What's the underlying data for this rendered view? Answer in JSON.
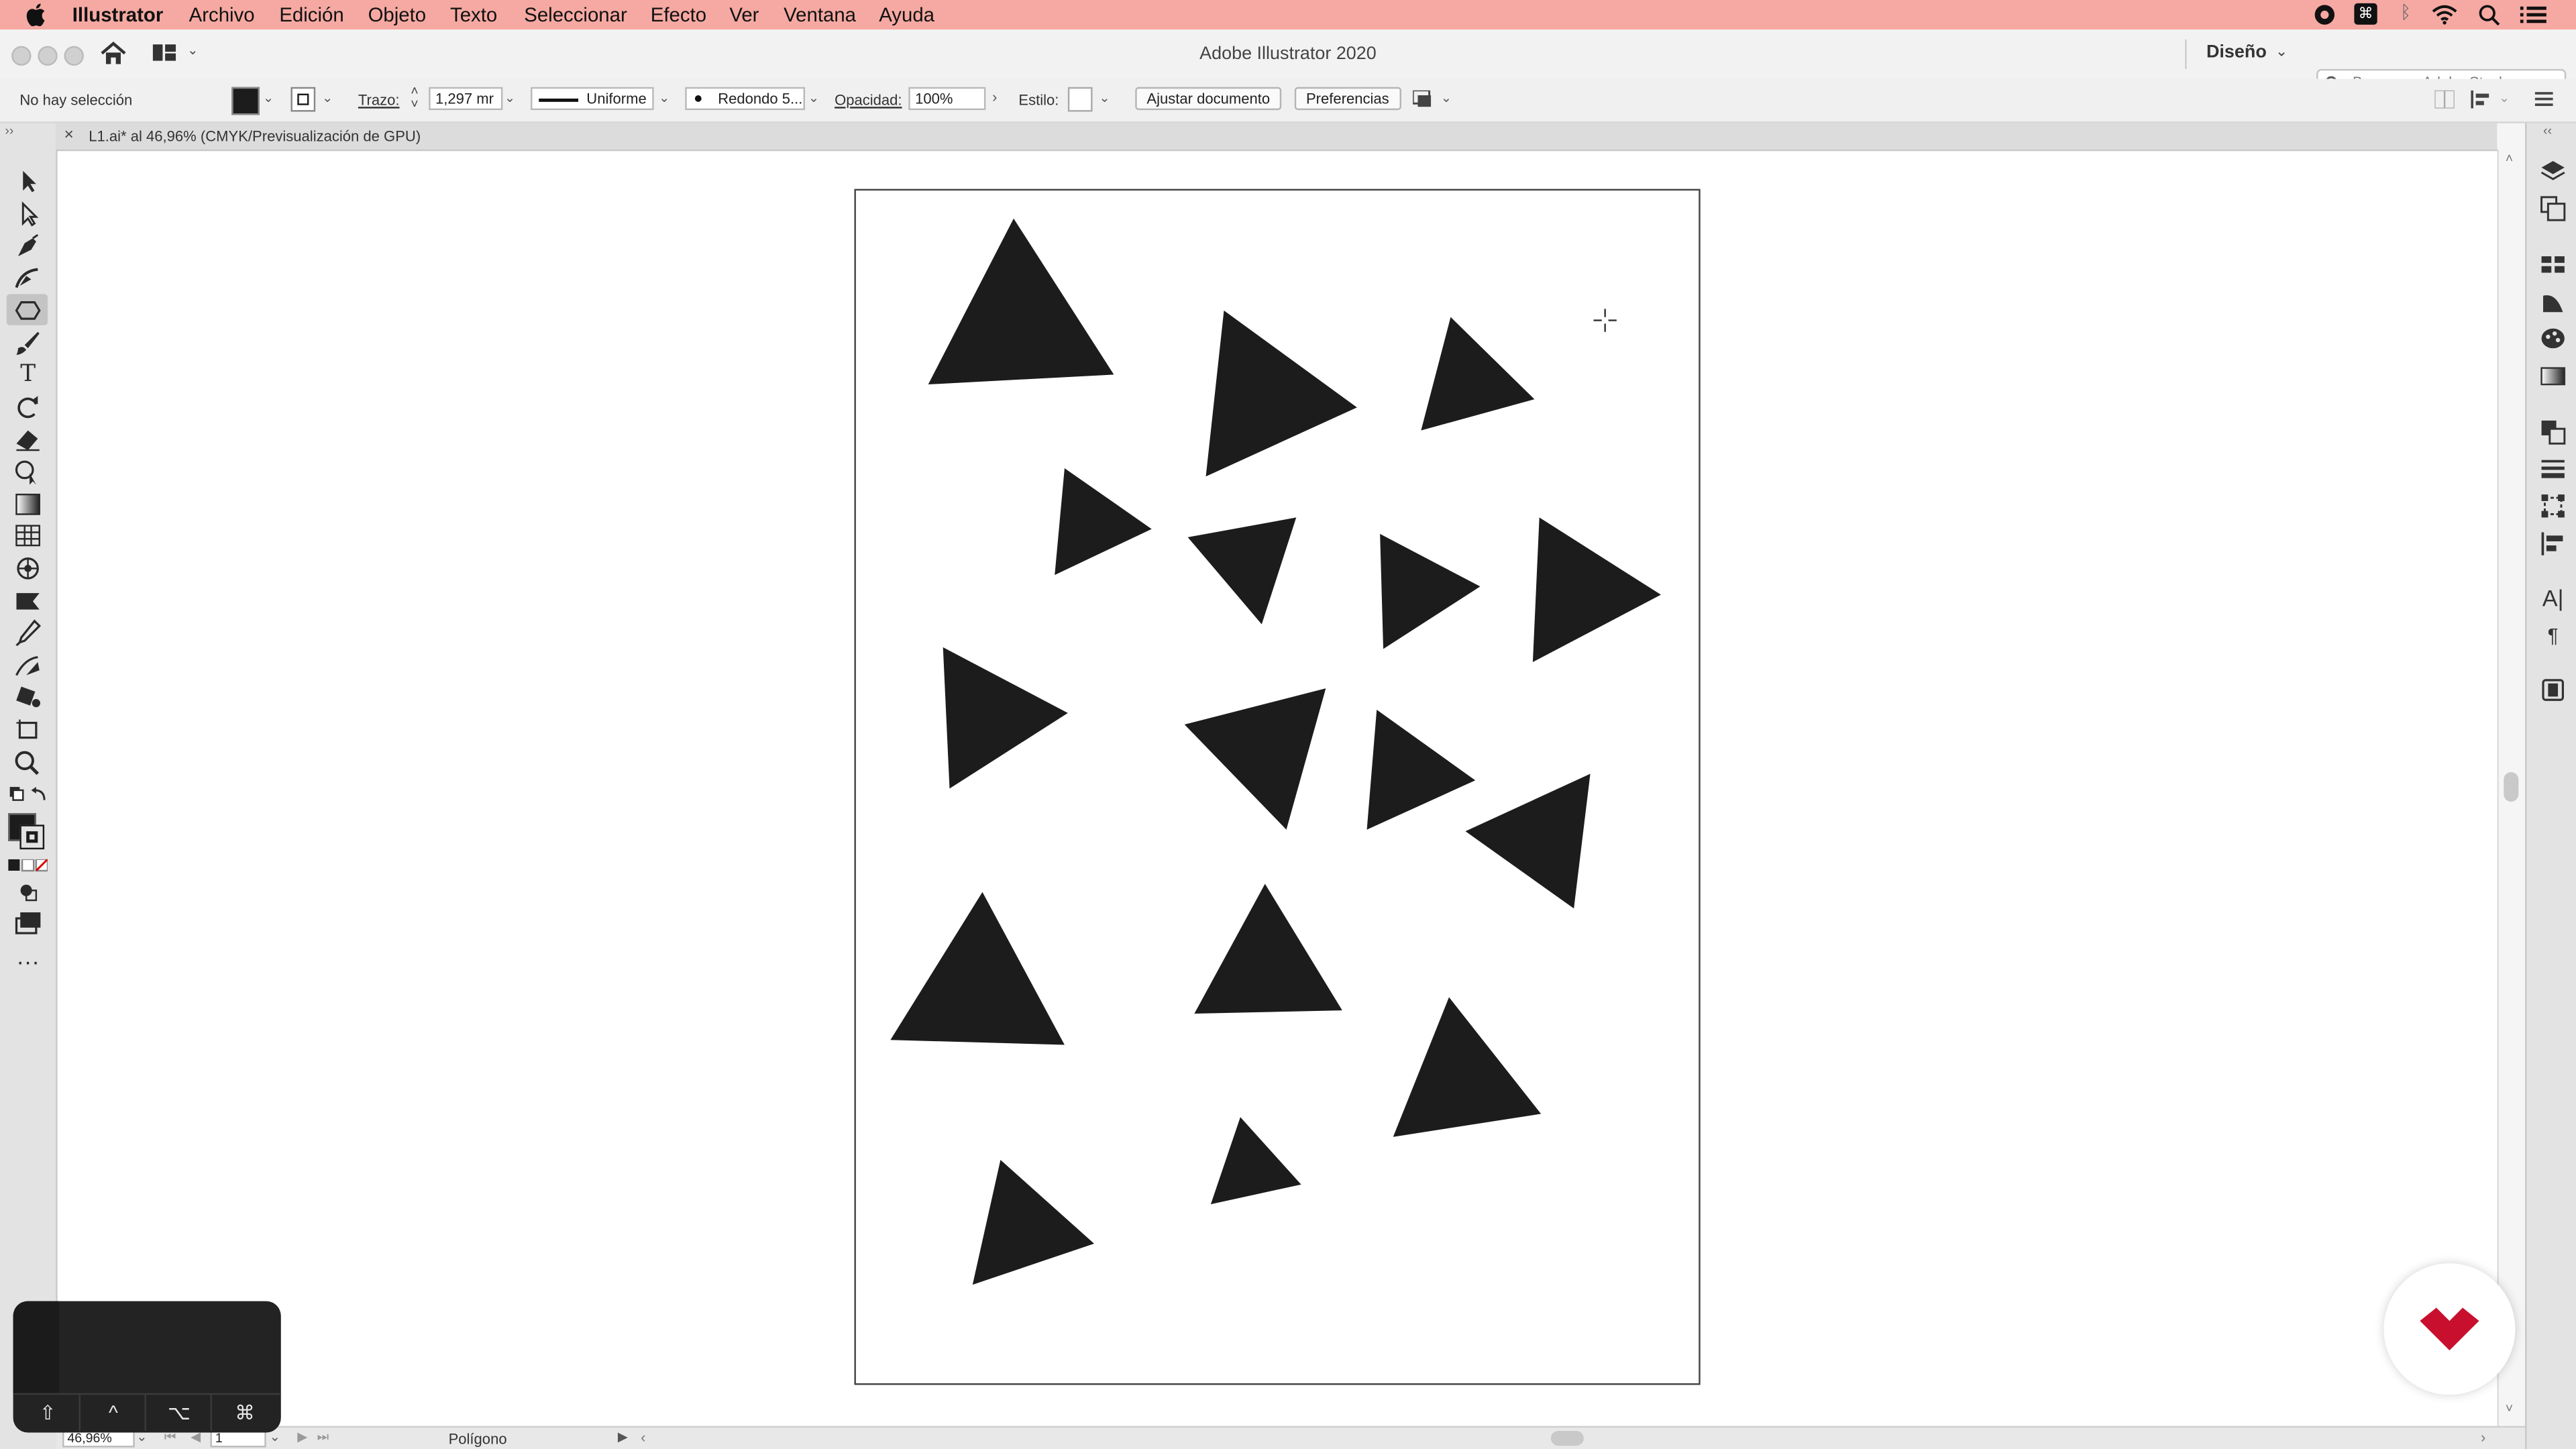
{
  "menubar": {
    "apple_icon": "apple-icon",
    "app_name": "Illustrator",
    "items": [
      "Archivo",
      "Edición",
      "Objeto",
      "Texto",
      "Seleccionar",
      "Efecto",
      "Ver",
      "Ventana",
      "Ayuda"
    ]
  },
  "titlebar": {
    "title": "Adobe Illustrator 2020",
    "workspace": "Diseño",
    "stock_search_placeholder": "Buscar en Adobe Stock"
  },
  "controlbar": {
    "selection_status": "No hay selección",
    "stroke_label": "Trazo:",
    "stroke_weight": "1,297 mr",
    "stroke_profile": "Uniforme",
    "brush": "Redondo 5...",
    "opacity_label": "Opacidad:",
    "opacity_value": "100%",
    "style_label": "Estilo:",
    "fit_document_button": "Ajustar documento",
    "preferences_button": "Preferencias"
  },
  "document_tab": {
    "close": "×",
    "label": "L1.ai* al 46,96% (CMYK/Previsualización de GPU)"
  },
  "statusbar": {
    "zoom": "46,96%",
    "artboard_number": "1",
    "current_tool": "Polígono"
  },
  "modifier_keys": [
    "⇧",
    "^",
    "⌥",
    "⌘"
  ],
  "colors": {
    "menubar": "#f5a9a2",
    "triangle_fill": "#1c1c1c",
    "logo_red": "#c8102e"
  }
}
